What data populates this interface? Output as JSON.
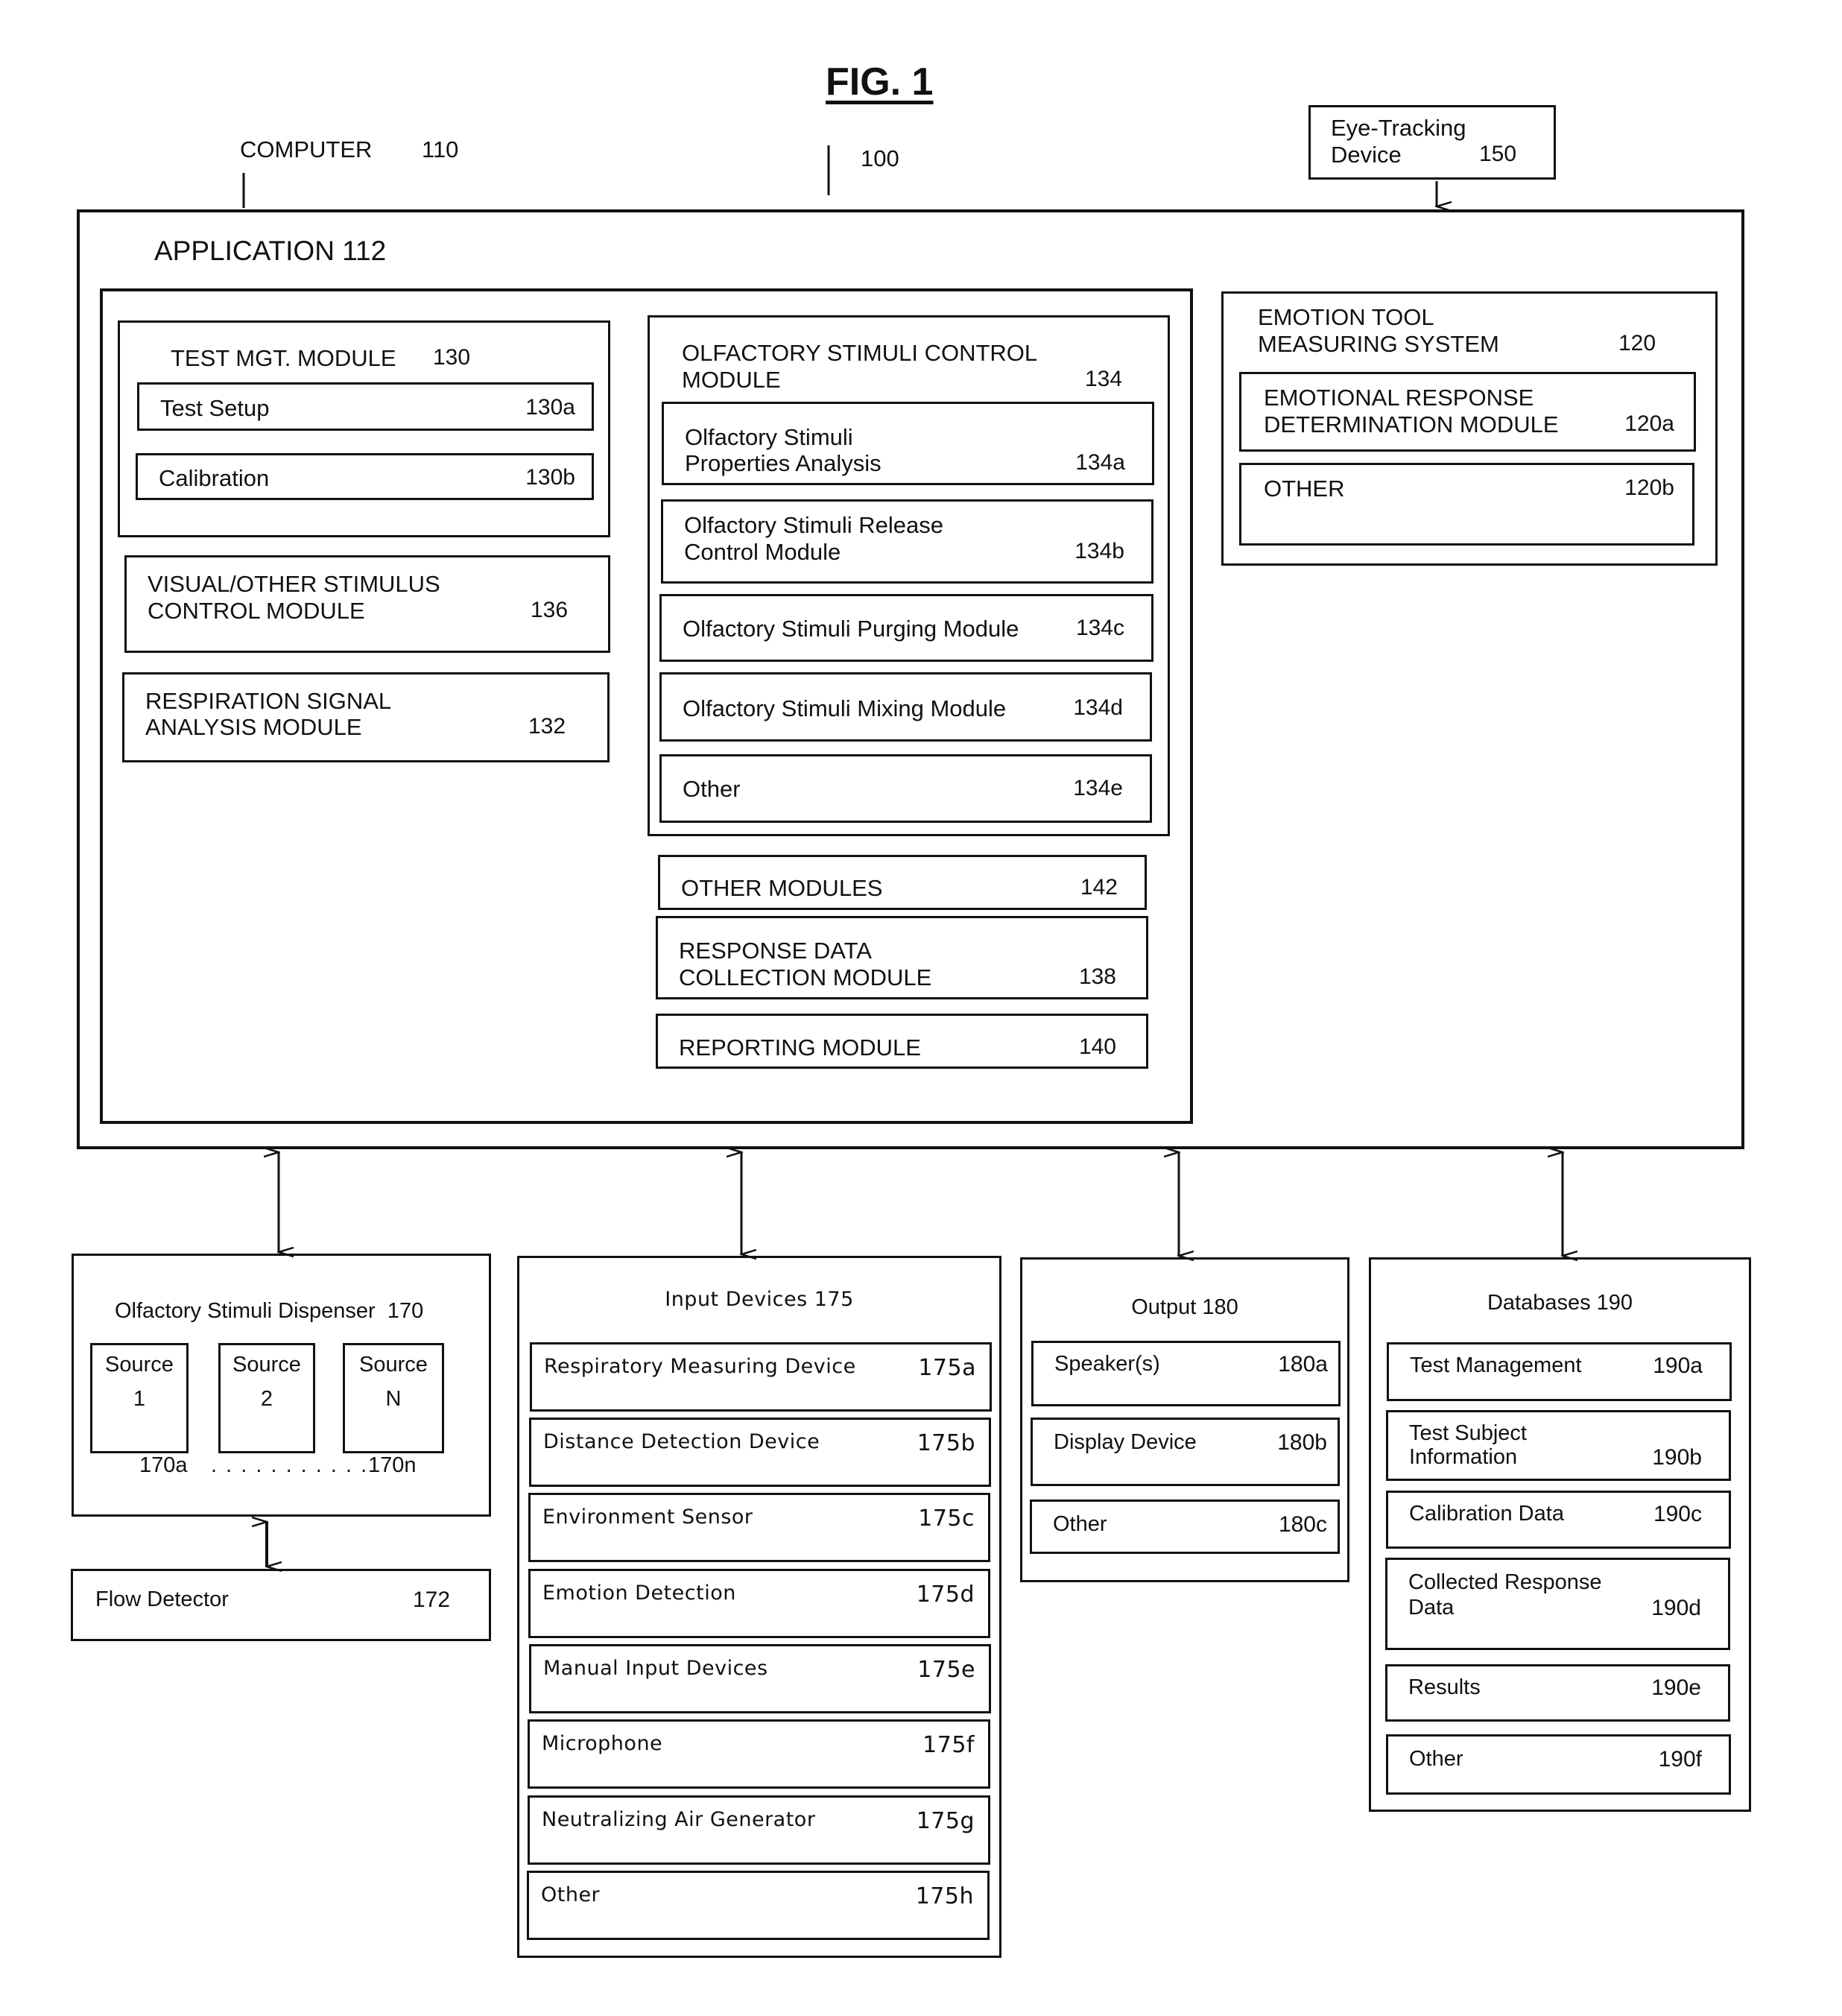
{
  "figure": {
    "title": "FIG. 1",
    "system_ref": "100",
    "computer_label": "COMPUTER",
    "computer_ref": "110",
    "eye_tracking": {
      "line1": "Eye-Tracking",
      "line2": "Device",
      "ref": "150"
    }
  },
  "application": {
    "title": "APPLICATION 112",
    "test_mgt": {
      "title": "TEST MGT. MODULE",
      "ref": "130",
      "items": [
        {
          "label": "Test Setup",
          "ref": "130a"
        },
        {
          "label": "Calibration",
          "ref": "130b"
        }
      ]
    },
    "visual": {
      "line1": "VISUAL/OTHER STIMULUS",
      "line2": "CONTROL MODULE",
      "ref": "136"
    },
    "respiration": {
      "line1": "RESPIRATION SIGNAL",
      "line2": "ANALYSIS MODULE",
      "ref": "132"
    },
    "olfactory": {
      "line1": "OLFACTORY STIMULI CONTROL",
      "line2": "MODULE",
      "ref": "134",
      "items": [
        {
          "line1": "Olfactory Stimuli",
          "line2": "Properties Analysis",
          "ref": "134a"
        },
        {
          "line1": "Olfactory Stimuli Release",
          "line2": "Control Module",
          "ref": "134b"
        },
        {
          "line1": "Olfactory Stimuli Purging Module",
          "line2": "",
          "ref": "134c"
        },
        {
          "line1": "Olfactory Stimuli Mixing Module",
          "line2": "",
          "ref": "134d"
        },
        {
          "line1": "Other",
          "line2": "",
          "ref": "134e"
        }
      ]
    },
    "other_modules": {
      "label": "OTHER MODULES",
      "ref": "142"
    },
    "response_data": {
      "line1": "RESPONSE DATA",
      "line2": "COLLECTION MODULE",
      "ref": "138"
    },
    "reporting": {
      "label": "REPORTING MODULE",
      "ref": "140"
    },
    "emotion_tool": {
      "line1": "EMOTION TOOL",
      "line2": "MEASURING SYSTEM",
      "ref": "120",
      "items": [
        {
          "line1": "EMOTIONAL RESPONSE",
          "line2": "DETERMINATION MODULE",
          "ref": "120a"
        },
        {
          "line1": "OTHER",
          "line2": "",
          "ref": "120b"
        }
      ]
    }
  },
  "dispenser": {
    "title": "Olfactory Stimuli Dispenser  170",
    "sources": [
      {
        "line1": "Source",
        "line2": "1"
      },
      {
        "line1": "Source",
        "line2": "2"
      },
      {
        "line1": "Source",
        "line2": "N"
      }
    ],
    "ref_first": "170a",
    "ellipsis": ". . . . . . . . . . .",
    "ref_last": "170n"
  },
  "flow_detector": {
    "label": "Flow Detector",
    "ref": "172"
  },
  "input_devices": {
    "title": "Input Devices 175",
    "items": [
      {
        "label": "Respiratory Measuring Device",
        "ref": "175a"
      },
      {
        "label": "Distance Detection Device",
        "ref": "175b"
      },
      {
        "label": "Environment Sensor",
        "ref": "175c"
      },
      {
        "label": "Emotion Detection",
        "ref": "175d"
      },
      {
        "label": "Manual Input Devices",
        "ref": "175e"
      },
      {
        "label": "Microphone",
        "ref": "175f"
      },
      {
        "label": "Neutralizing Air Generator",
        "ref": "175g"
      },
      {
        "label": "Other",
        "ref": "175h"
      }
    ]
  },
  "output": {
    "title": "Output 180",
    "items": [
      {
        "label": "Speaker(s)",
        "ref": "180a"
      },
      {
        "label": "Display Device",
        "ref": "180b"
      },
      {
        "label": "Other",
        "ref": "180c"
      }
    ]
  },
  "databases": {
    "title": "Databases 190",
    "items": [
      {
        "line1": "Test Management",
        "line2": "",
        "ref": "190a"
      },
      {
        "line1": "Test Subject",
        "line2": "Information",
        "ref": "190b"
      },
      {
        "line1": "Calibration Data",
        "line2": "",
        "ref": "190c"
      },
      {
        "line1": "Collected Response",
        "line2": "Data",
        "ref": "190d"
      },
      {
        "line1": "Results",
        "line2": "",
        "ref": "190e"
      },
      {
        "line1": "Other",
        "line2": "",
        "ref": "190f"
      }
    ]
  }
}
